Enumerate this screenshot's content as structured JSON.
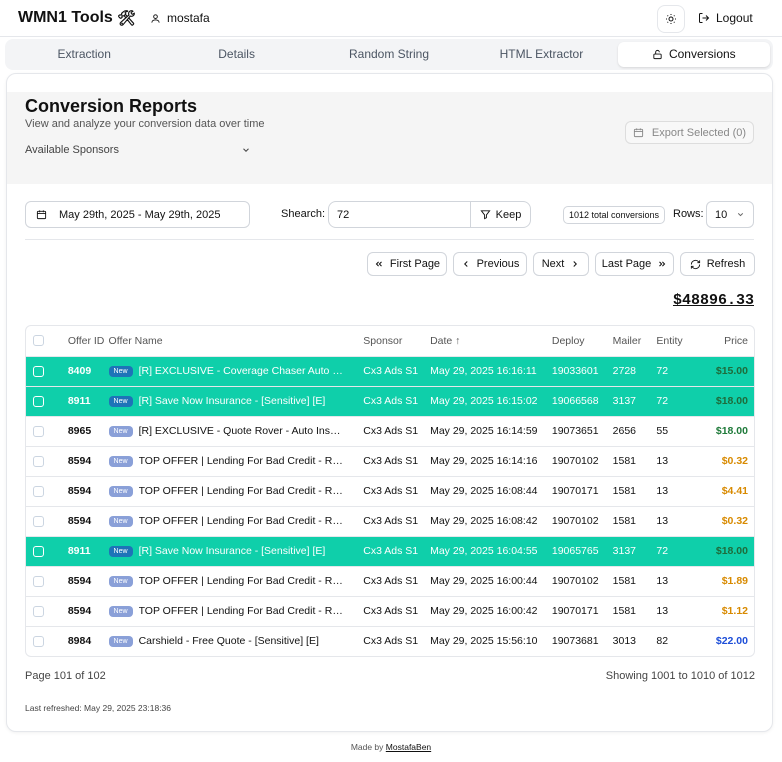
{
  "app": {
    "brand": "WMN1 Tools",
    "brand_icon": "tools-icon",
    "user": "mostafa",
    "logout_label": "Logout"
  },
  "tabs": [
    {
      "label": "Extraction",
      "active": false
    },
    {
      "label": "Details",
      "active": false
    },
    {
      "label": "Random String",
      "active": false
    },
    {
      "label": "HTML Extractor",
      "active": false
    },
    {
      "label": "Conversions",
      "active": true
    }
  ],
  "page": {
    "title": "Conversion Reports",
    "subtitle": "View and analyze your conversion data over time",
    "sponsors_label": "Available Sponsors",
    "export_label": "Export Selected (0)"
  },
  "filters": {
    "date_range": "May 29th, 2025 - May 29th, 2025",
    "search_label": "Shearch:",
    "search_value": "72",
    "keep_label": "Keep",
    "total_conversions": "1012 total conversions",
    "rows_label": "Rows:",
    "rows_value": "10"
  },
  "pagination": {
    "first": "First Page",
    "previous": "Previous",
    "next": "Next",
    "last": "Last Page",
    "refresh": "Refresh"
  },
  "total_amount": "$48896.33",
  "table": {
    "columns": [
      "Offer ID",
      "Offer Name",
      "Sponsor",
      "Date ↑",
      "Deploy",
      "Mailer",
      "Entity",
      "Price"
    ],
    "badge": "New",
    "rows": [
      {
        "offer_id": "8409",
        "offer_name": "[R] EXCLUSIVE - Coverage Chaser Auto Surance",
        "sponsor": "Cx3 Ads S1",
        "date": "May 29, 2025 16:16:11",
        "deploy": "19033601",
        "mailer": "2728",
        "entity": "72",
        "price": "$15.00",
        "highlight": true,
        "price_color": "green"
      },
      {
        "offer_id": "8911",
        "offer_name": "[R] Save Now Insurance - [Sensitive] [E]",
        "sponsor": "Cx3 Ads S1",
        "date": "May 29, 2025 16:15:02",
        "deploy": "19066568",
        "mailer": "3137",
        "entity": "72",
        "price": "$18.00",
        "highlight": true,
        "price_color": "green"
      },
      {
        "offer_id": "8965",
        "offer_name": "[R] EXCLUSIVE - Quote Rover - Auto Insurance",
        "sponsor": "Cx3 Ads S1",
        "date": "May 29, 2025 16:14:59",
        "deploy": "19073651",
        "mailer": "2656",
        "entity": "55",
        "price": "$18.00",
        "highlight": false,
        "price_color": "green"
      },
      {
        "offer_id": "8594",
        "offer_name": "TOP OFFER | Lending For Bad Credit - REVSHARE",
        "sponsor": "Cx3 Ads S1",
        "date": "May 29, 2025 16:14:16",
        "deploy": "19070102",
        "mailer": "1581",
        "entity": "13",
        "price": "$0.32",
        "highlight": false,
        "price_color": "orange"
      },
      {
        "offer_id": "8594",
        "offer_name": "TOP OFFER | Lending For Bad Credit - REVSHARE",
        "sponsor": "Cx3 Ads S1",
        "date": "May 29, 2025 16:08:44",
        "deploy": "19070171",
        "mailer": "1581",
        "entity": "13",
        "price": "$4.41",
        "highlight": false,
        "price_color": "orange"
      },
      {
        "offer_id": "8594",
        "offer_name": "TOP OFFER | Lending For Bad Credit - REVSHARE",
        "sponsor": "Cx3 Ads S1",
        "date": "May 29, 2025 16:08:42",
        "deploy": "19070102",
        "mailer": "1581",
        "entity": "13",
        "price": "$0.32",
        "highlight": false,
        "price_color": "orange"
      },
      {
        "offer_id": "8911",
        "offer_name": "[R] Save Now Insurance - [Sensitive] [E]",
        "sponsor": "Cx3 Ads S1",
        "date": "May 29, 2025 16:04:55",
        "deploy": "19065765",
        "mailer": "3137",
        "entity": "72",
        "price": "$18.00",
        "highlight": true,
        "price_color": "green"
      },
      {
        "offer_id": "8594",
        "offer_name": "TOP OFFER | Lending For Bad Credit - REVSHARE",
        "sponsor": "Cx3 Ads S1",
        "date": "May 29, 2025 16:00:44",
        "deploy": "19070102",
        "mailer": "1581",
        "entity": "13",
        "price": "$1.89",
        "highlight": false,
        "price_color": "orange"
      },
      {
        "offer_id": "8594",
        "offer_name": "TOP OFFER | Lending For Bad Credit - REVSHARE",
        "sponsor": "Cx3 Ads S1",
        "date": "May 29, 2025 16:00:42",
        "deploy": "19070171",
        "mailer": "1581",
        "entity": "13",
        "price": "$1.12",
        "highlight": false,
        "price_color": "orange"
      },
      {
        "offer_id": "8984",
        "offer_name": "Carshield - Free Quote - [Sensitive] [E]",
        "sponsor": "Cx3 Ads S1",
        "date": "May 29, 2025 15:56:10",
        "deploy": "19073681",
        "mailer": "3013",
        "entity": "82",
        "price": "$22.00",
        "highlight": false,
        "price_color": "blue"
      }
    ]
  },
  "footer": {
    "page_info": "Page 101 of 102",
    "showing": "Showing 1001 to 1010 of 1012",
    "last_refreshed": "Last refreshed: May 29, 2025 23:18:36"
  },
  "credit": {
    "prefix": "Made by",
    "author": "MostafaBen"
  },
  "colors": {
    "highlight_row": "#0fcfaa",
    "price_green": "#1f7a3a",
    "price_orange": "#d88a00",
    "price_blue": "#1d4ed8",
    "badge": "#8aa0d8"
  }
}
